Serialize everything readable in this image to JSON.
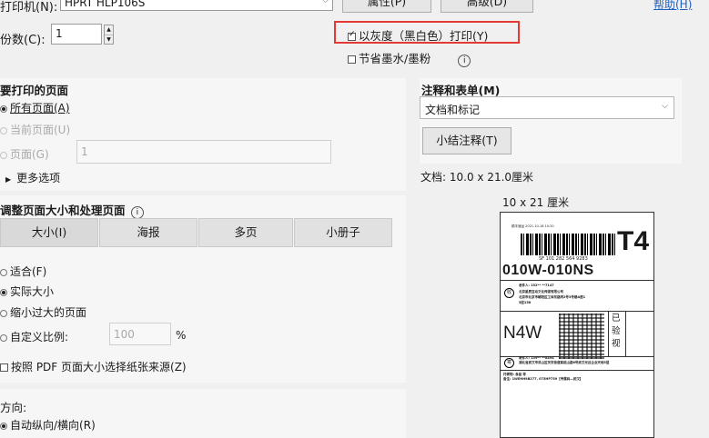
{
  "top": {
    "printer_label": "打印机(N):",
    "printer_value": "HPRT HLP106S",
    "properties_btn": "属性(P)",
    "advanced_btn": "高级(D)",
    "help_link": "帮助(H)",
    "copies_label": "份数(C):",
    "copies_value": "1",
    "grayscale_label": "以灰度（黑白色）打印(Y)",
    "save_ink_label": "节省墨水/墨粉",
    "highlight_color": "#e53935"
  },
  "pages": {
    "title": "要打印的页面",
    "all_pages": "所有页面(A)",
    "current_page": "当前页面(U)",
    "pages_label": "页面(G)",
    "pages_value": "1",
    "more_options": "更多选项"
  },
  "sizing": {
    "title": "调整页面大小和处理页面",
    "tabs": [
      "大小(I)",
      "海报",
      "多页",
      "小册子"
    ],
    "fit": "适合(F)",
    "actual_size": "实际大小",
    "shrink": "缩小过大的页面",
    "custom_scale": "自定义比例:",
    "custom_scale_value": "100",
    "percent": "%",
    "choose_source": "按照 PDF 页面大小选择纸张来源(Z)"
  },
  "orientation": {
    "title": "方向:",
    "auto": "自动纵向/横向(R)"
  },
  "comments": {
    "title": "注释和表单(M)",
    "select_value": "文档和标记",
    "summarize_btn": "小结注释(T)"
  },
  "preview": {
    "doc_size": "文档:  10.0 x 21.0厘米",
    "paper_size": "10 x 21 厘米",
    "label": {
      "top_small": "顺丰速运  2021-10-18  10:20",
      "tracking": "SF 101 282 564 9283",
      "big_code": "T4",
      "route": "010W-010NS",
      "receiver_line1": "收件人: 152**  **7147",
      "receiver_line2": "北京星辰互动文化传媒有限公司",
      "receiver_line3": "北京市北京市朝阳区工体东路丙2号3号楼A座1",
      "receiver_line4": "5层158",
      "mark_circle_1": "收",
      "mark_circle_2": "寄",
      "area_code": "N4W",
      "inspected": "已验视",
      "sender_line1": "寄件人: 139**  **8494",
      "sender_line2": "湖北省武汉市洪山区关东街道紫菘山路6号武汉光谷企业天地5层",
      "footer_line1": "托寄物: 食品 等",
      "footer_line2": "备注: 1WEHH9B277, 075HP759【专属码—武汉】"
    }
  }
}
